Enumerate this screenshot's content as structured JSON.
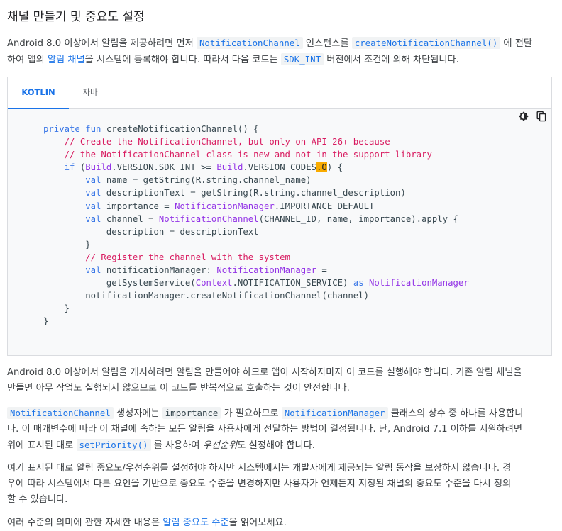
{
  "title": "채널 만들기 및 중요도 설정",
  "intro": {
    "l1a": "Android 8.0 이상에서 알림을 제공하려면 먼저 ",
    "code1": "NotificationChannel",
    "l1b": " 인스턴스를 ",
    "code2": "createNotificationChannel()",
    "l1c": " 에 전달",
    "l2a": "하여 앱의 ",
    "link1": "알림 채널",
    "l2b": "을 시스템에 등록해야 합니다. 따라서 다음 코드는 ",
    "code3": "SDK_INT",
    "l2c": " 버전에서 조건에 의해 차단됩니다."
  },
  "tabs": {
    "kotlin": "KOTLIN",
    "java": "자바"
  },
  "code": {
    "c1a": "private fun",
    "c1b": " createNotificationChannel() {",
    "c2": "    // Create the NotificationChannel, but only on API 26+ because",
    "c3": "    // the NotificationChannel class is new and not in the support library",
    "c4kw": "    if",
    "c4a": " (",
    "c4ty1": "Build",
    "c4b": ".VERSION.SDK_INT >= ",
    "c4ty2": "Build",
    "c4c": ".VERSION_CODES",
    "c4hl": ".O",
    "c4d": ") {",
    "val": "val",
    "c5": " name = getString(R.string.channel_name)",
    "c6": " descriptionText = getString(R.string.channel_description)",
    "c7a": " importance = ",
    "c7ty": "NotificationManager",
    "c7b": ".IMPORTANCE_DEFAULT",
    "c8a": " channel = ",
    "c8ty": "NotificationChannel",
    "c8b": "(CHANNEL_ID, name, importance).apply {",
    "c9": "            description = descriptionText",
    "c10": "        }",
    "c11": "        // Register the channel with the system",
    "c12a": " notificationManager: ",
    "c12ty": "NotificationManager",
    "c12b": " =",
    "c13a": "            getSystemService(",
    "c13ty1": "Context",
    "c13b": ".NOTIFICATION_SERVICE) ",
    "c13as": "as",
    "c13c": " ",
    "c13ty2": "NotificationManager",
    "c14": "        notificationManager.createNotificationChannel(channel)",
    "c15": "    }",
    "c16": "}"
  },
  "para2": {
    "l1": "Android 8.0 이상에서 알림을 게시하려면 알림을 만들어야 하므로 앱이 시작하자마자 이 코드를 실행해야 합니다. 기존 알림 채널을",
    "l2": "만들면 아무 작업도 실행되지 않으므로 이 코드를 반복적으로 호출하는 것이 안전합니다."
  },
  "para3": {
    "code1": "NotificationChannel",
    "l1a": " 생성자에는 ",
    "code2": "importance",
    "l1b": " 가 필요하므로 ",
    "code3": "NotificationManager",
    "l1c": " 클래스의 상수 중 하나를 사용합니",
    "l2": "다. 이 매개변수에 따라 이 채널에 속하는 모든 알림을 사용자에게 전달하는 방법이 결정됩니다. 단, Android 7.1 이하를 지원하려면",
    "l3a": "위에 표시된 대로 ",
    "code4": "setPriority()",
    "l3b": " 를 사용하여 ",
    "em": "우선순위",
    "l3c": "도 설정해야 합니다."
  },
  "para4": {
    "l1": "여기 표시된 대로 알림 중요도/우선순위를 설정해야 하지만 시스템에서는 개발자에게 제공되는 알림 동작을 보장하지 않습니다. 경",
    "l2": "우에 따라 시스템에서 다른 요인을 기반으로 중요도 수준을 변경하지만 사용자가 언제든지 지정된 채널의 중요도 수준을 다시 정의",
    "l3": "할 수 있습니다."
  },
  "para5": {
    "a": "여러 수준의 의미에 관한 자세한 내용은 ",
    "link": "알림 중요도 수준",
    "b": "을 읽어보세요."
  },
  "icons": {
    "theme": "dark-mode-toggle-icon",
    "copy": "copy-icon"
  },
  "colors": {
    "link": "#1a73e8",
    "keyword": "#3b78e7",
    "comment": "#d81b60",
    "type": "#9334e6",
    "highlight": "#f9ab00"
  }
}
